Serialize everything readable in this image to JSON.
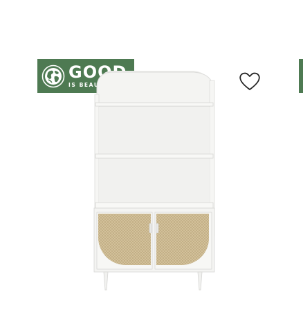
{
  "badge": {
    "line1": "GOOD",
    "line2": "IS BEAUTIFUL",
    "icon": "globe-icon",
    "color": "#4e7a52"
  },
  "wishlist": {
    "icon": "heart-outline-icon"
  },
  "product": {
    "image": "white-bookshelf-cabinet-with-rattan-doors"
  },
  "colors": {
    "badge_green": "#4e7a52",
    "cabinet_white": "#f3f3f1",
    "rattan": "#d9c8a3"
  }
}
